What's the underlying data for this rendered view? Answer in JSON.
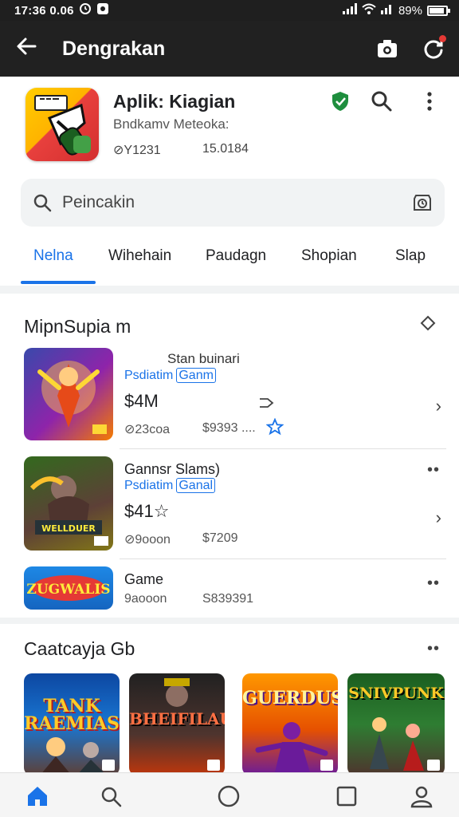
{
  "status_bar": {
    "time": "17:36 0.06",
    "battery": "89%",
    "battery_level": 0.89
  },
  "app_bar": {
    "title": "Dengrakan",
    "back_icon": "arrow-left-icon",
    "actions": [
      "camera-icon",
      "notification-icon"
    ]
  },
  "app_header": {
    "name": "Aplik: Kiagian",
    "developer": "Bndkamv Meteoka:",
    "meta_left": "⊘Y1231",
    "meta_right": "15.0184"
  },
  "search": {
    "placeholder": "Peincakin"
  },
  "tabs": [
    {
      "label": "Nelna",
      "active": true
    },
    {
      "label": "Wihehain",
      "active": false
    },
    {
      "label": "Paudagn",
      "active": false
    },
    {
      "label": "Shopian",
      "active": false
    },
    {
      "label": "Slap",
      "active": false
    }
  ],
  "section1": {
    "title": "MipnSupia m",
    "items": [
      {
        "top_label": "Stan buinari",
        "subtitle": "Psdiatim",
        "badge": "Ganm",
        "price": "$4M",
        "meta_left": "⊘23coa",
        "meta_right": "$9393 ....",
        "rating_stars": 1
      },
      {
        "title": "Gannsr Slams)",
        "subtitle": "Psdiatim",
        "badge": "Ganal",
        "price": "$41☆",
        "meta_left": "⊘9ooon",
        "meta_right": "$7209"
      },
      {
        "title": "Game",
        "meta_left": "9aooon",
        "meta_right": "S839391"
      }
    ],
    "thumb_titles": [
      "",
      "WELLDUER",
      "ZUGWALIS"
    ]
  },
  "section2": {
    "title": "Caatcayja Gb",
    "cards": [
      {
        "title": "TANK RAEMIAS"
      },
      {
        "title": "BHEIFILAUS"
      },
      {
        "title": "GUERDUS"
      },
      {
        "title": "SNIVPUNK"
      }
    ]
  },
  "colors": {
    "accent": "#1a73e8",
    "appbar": "#212121",
    "verified": "#1e8e3e"
  }
}
